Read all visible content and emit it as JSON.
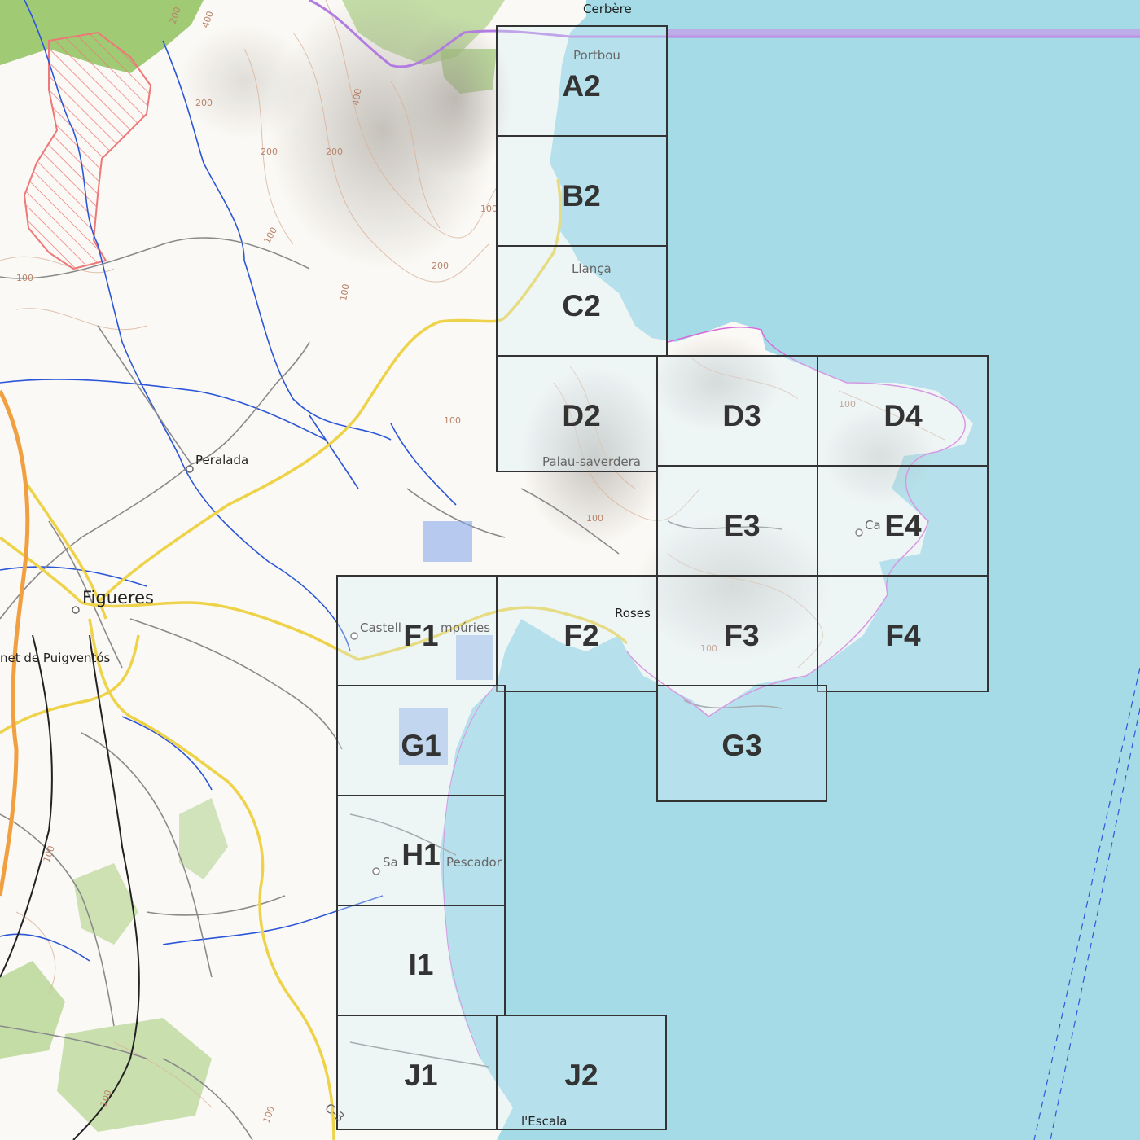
{
  "map": {
    "colors": {
      "sea": "#a5dbe6",
      "land": "#fbf9f5",
      "tile_fill": "#d6eff6",
      "tile_border": "#333333",
      "border_line": "#b27de0",
      "river": "#2b56d8",
      "road_major": "#f0dd55",
      "motorway": "#f0a040"
    },
    "tiles": [
      "A2",
      "B2",
      "C2",
      "D2",
      "D3",
      "D4",
      "E3",
      "E4",
      "F1",
      "F2",
      "F3",
      "F4",
      "G1",
      "G3",
      "H1",
      "I1",
      "J1",
      "J2"
    ],
    "places": {
      "cerbere": "Cerbère",
      "portbou": "Portbou",
      "llanca": "Llança",
      "palau": "Palau-saverdera",
      "peralada": "Peralada",
      "figueres": "Figueres",
      "puigventos": "net de Puigventós",
      "castello": "Castell",
      "castello_end": "mpúries",
      "roses": "Roses",
      "cadaques": "Ca",
      "sant_pere_a": "Sa",
      "sant_pere_b": "Pescador",
      "lescala": "l'Escala",
      "road_c31": "C-3"
    },
    "contours": [
      "200",
      "400",
      "400",
      "200",
      "200",
      "200",
      "100",
      "100",
      "100",
      "100",
      "200",
      "100",
      "100",
      "100",
      "100",
      "100",
      "100",
      "100"
    ]
  }
}
